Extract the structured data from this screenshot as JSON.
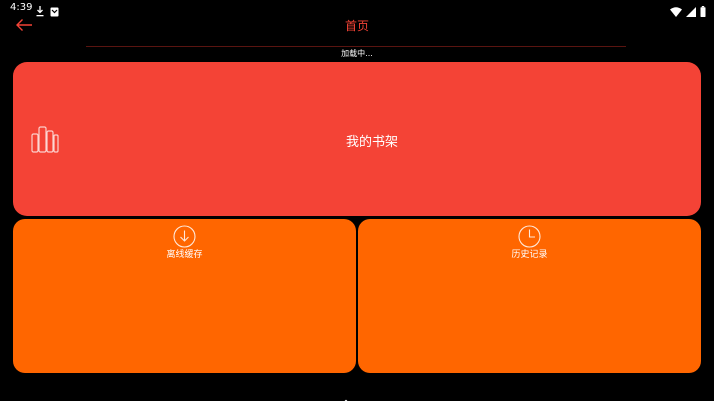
{
  "status_bar": {
    "time": "4:39",
    "left_icons": [
      "download-icon",
      "notification-box-icon"
    ],
    "right_icons": [
      "wifi-icon",
      "signal-icon",
      "battery-icon"
    ]
  },
  "app_bar": {
    "title": "首页",
    "back_icon": "arrow-left-icon"
  },
  "loading": {
    "text": "加载中..."
  },
  "cards": {
    "bookshelf": {
      "label": "我的书架",
      "icon": "bookshelf-icon",
      "color": "#f44336"
    },
    "offline": {
      "label": "离线缓存",
      "icon": "download-circle-icon",
      "color": "#ff6600"
    },
    "history": {
      "label": "历史记录",
      "icon": "clock-icon",
      "color": "#ff6600"
    }
  },
  "pager": {
    "items": [
      "home-icon",
      "dot",
      "dot"
    ],
    "selected_index": 0
  },
  "colors": {
    "accent": "#f44336",
    "orange": "#ff6600",
    "background": "#000000"
  }
}
